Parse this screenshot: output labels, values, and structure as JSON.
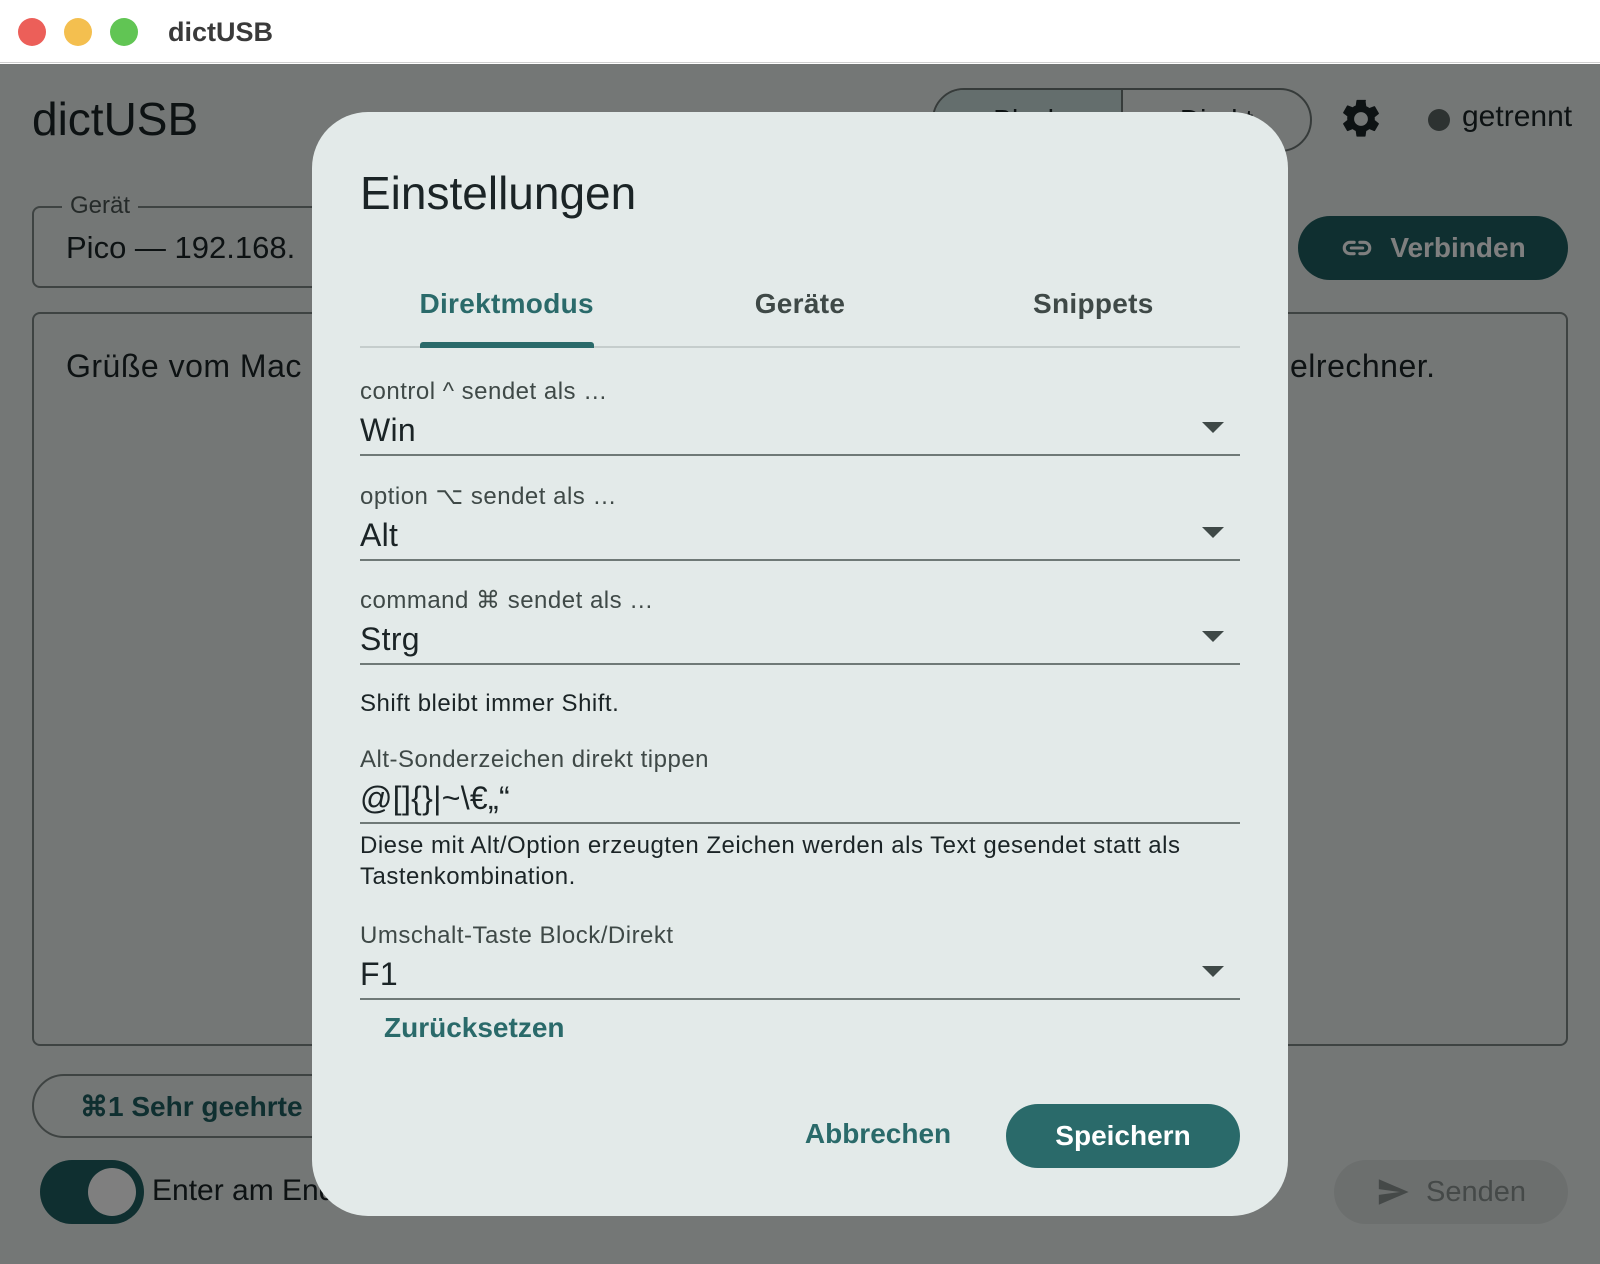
{
  "window": {
    "title": "dictUSB"
  },
  "app": {
    "title": "dictUSB",
    "mode_toggle": {
      "block_label": "Block",
      "direct_label": "Direkt"
    },
    "status": {
      "text": "getrennt"
    },
    "device": {
      "label": "Gerät",
      "value": "Pico — 192.168."
    },
    "connect_button": "Verbinden",
    "editor": {
      "text_start": "Grüße vom Mac",
      "text_end": "elrechner."
    },
    "snippet_chip": "⌘1 Sehr geehrte",
    "enter_switch": {
      "label": "Enter am End",
      "on": true
    },
    "send_button": "Senden"
  },
  "dialog": {
    "title": "Einstellungen",
    "tabs": [
      {
        "label": "Direktmodus",
        "active": true
      },
      {
        "label": "Geräte",
        "active": false
      },
      {
        "label": "Snippets",
        "active": false
      }
    ],
    "fields": {
      "control": {
        "label": "control ^ sendet als …",
        "value": "Win"
      },
      "option": {
        "label": "option ⌥ sendet als …",
        "value": "Alt"
      },
      "command": {
        "label": "command ⌘ sendet als …",
        "value": "Strg"
      },
      "shift_note": "Shift bleibt immer Shift.",
      "alt_chars": {
        "label": "Alt-Sonderzeichen direkt tippen",
        "value": "@[]{}|~\\€„“"
      },
      "alt_help": "Diese mit Alt/Option erzeugten Zeichen werden als Text gesendet statt als Tastenkombination.",
      "switch_key": {
        "label": "Umschalt-Taste Block/Direkt",
        "value": "F1"
      }
    },
    "reset_link": "Zurücksetzen",
    "cancel_button": "Abbrechen",
    "save_button": "Speichern"
  },
  "colors": {
    "accent": "#2a6a6a",
    "accent_dark": "#1e5f60",
    "dialog_bg": "#e3eae9",
    "scrim": "rgba(0,0,0,0.5)"
  },
  "icons": {
    "settings": "gear-icon",
    "connect": "link-icon",
    "send": "send-icon",
    "dropdown": "triangle-down-icon"
  }
}
